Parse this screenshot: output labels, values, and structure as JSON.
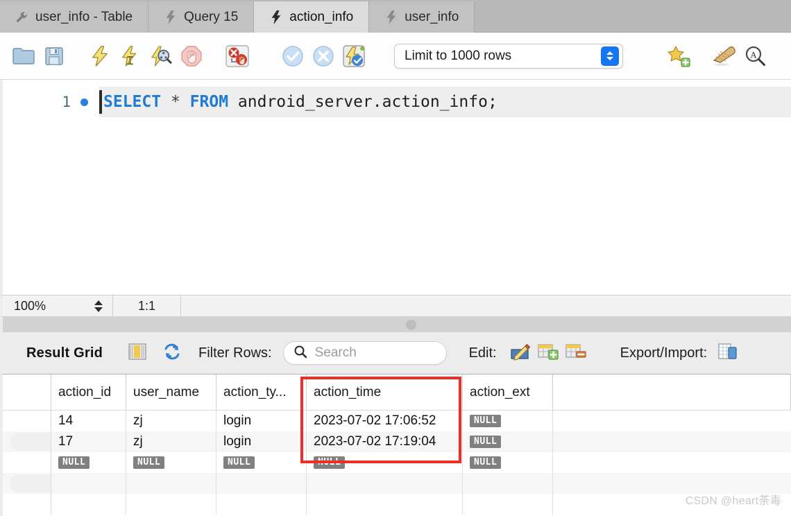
{
  "tabs": [
    {
      "label": "user_info - Table",
      "icon": "wrench-icon",
      "active": false
    },
    {
      "label": "Query 15",
      "icon": "lightning-icon",
      "active": false
    },
    {
      "label": "action_info",
      "icon": "lightning-icon",
      "active": true
    },
    {
      "label": "user_info",
      "icon": "lightning-icon",
      "active": false
    }
  ],
  "toolbar": {
    "buttons": [
      {
        "name": "open-sql-file-icon",
        "title": "Open a SQL script file"
      },
      {
        "name": "save-sql-file-icon",
        "title": "Save SQL script to file"
      },
      {
        "name": "execute-statement-icon",
        "title": "Execute the selected portion or everything"
      },
      {
        "name": "execute-current-statement-icon",
        "title": "Execute the statement under the keyboard cursor"
      },
      {
        "name": "explain-statement-icon",
        "title": "Execute EXPLAIN on the statement under the cursor"
      },
      {
        "name": "stop-execution-icon",
        "title": "Stop the query being executed"
      },
      {
        "name": "toggle-stop-on-error-icon",
        "title": "Toggle whether execution should stop on errors"
      },
      {
        "name": "commit-icon",
        "title": "Commit"
      },
      {
        "name": "rollback-icon",
        "title": "Rollback"
      },
      {
        "name": "toggle-autocommit-icon",
        "title": "Toggle auto-commit mode"
      }
    ],
    "limit_value": "Limit to 1000 rows",
    "right_buttons": [
      {
        "name": "save-snippet-icon",
        "title": "Save current statement to snippets list"
      },
      {
        "name": "beautify-query-icon",
        "title": "Beautify/reformat the SQL script"
      },
      {
        "name": "find-icon",
        "title": "Show the Find panel for the editor"
      }
    ]
  },
  "editor": {
    "line_number": "1",
    "sql_keyword_select": "SELECT",
    "sql_star": "*",
    "sql_keyword_from": "FROM",
    "sql_table": "android_server.action_info;"
  },
  "status": {
    "zoom": "100%",
    "cursor_position": "1:1"
  },
  "result_toolbar": {
    "title": "Result Grid",
    "filter_label": "Filter Rows:",
    "search_placeholder": "Search",
    "edit_label": "Edit:",
    "export_label": "Export/Import:",
    "icons": [
      {
        "name": "grid-columns-icon"
      },
      {
        "name": "refresh-icon"
      },
      {
        "name": "search-icon"
      },
      {
        "name": "edit-row-icon"
      },
      {
        "name": "insert-row-icon"
      },
      {
        "name": "delete-row-icon"
      },
      {
        "name": "export-recordset-icon"
      }
    ]
  },
  "grid": {
    "columns": [
      "action_id",
      "user_name",
      "action_ty...",
      "action_time",
      "action_ext",
      ""
    ],
    "rows": [
      {
        "cells": [
          "14",
          "zj",
          "login",
          "2023-07-02 17:06:52",
          "NULL",
          ""
        ],
        "selected": false
      },
      {
        "cells": [
          "17",
          "zj",
          "login",
          "2023-07-02 17:19:04",
          "NULL",
          ""
        ],
        "selected": true
      },
      {
        "cells": [
          "NULL",
          "NULL",
          "NULL",
          "NULL",
          "NULL",
          ""
        ],
        "selected": false
      },
      {
        "cells": [
          "",
          "",
          "",
          "",
          "",
          ""
        ],
        "selected": true
      },
      {
        "cells": [
          "",
          "",
          "",
          "",
          "",
          ""
        ],
        "selected": false
      }
    ]
  },
  "annotation": {
    "highlight_color": "#ee2e24",
    "highlighted_column": "action_time"
  },
  "watermark": "CSDN @heart荼毒"
}
